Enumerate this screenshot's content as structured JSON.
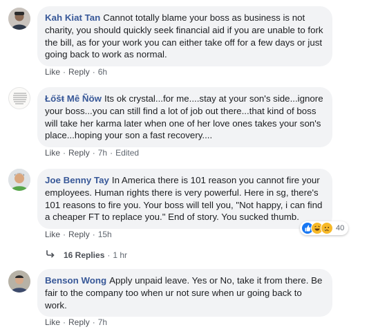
{
  "comments": [
    {
      "name": "Kah Kiat Tan",
      "text": "Cannot totally blame your boss as business is not charity, you should quickly seek financial aid if you are unable to fork the bill, as for your work you can either take off for a few days or just going back to work as normal.",
      "like": "Like",
      "reply": "Reply",
      "time": "6h"
    },
    {
      "name": "Łőšŧ Mê Ñöw",
      "text": "Its ok crystal...for me....stay at your son's side...ignore your boss...you can still find a lot of job out there...that kind of boss will take her karma later when one of her love ones takes your son's place...hoping your son a fast recovery....",
      "like": "Like",
      "reply": "Reply",
      "time": "7h",
      "edited": "Edited"
    },
    {
      "name": "Joe Benny Tay",
      "text": "In America there is 101 reason you cannot fire your employees. Human rights there is very powerful. Here in sg, there's 101 reasons to fire you. Your boss will tell you, \"Not happy, i can find a cheaper FT to replace you.\" End of story. You sucked thumb.",
      "like": "Like",
      "reply": "Reply",
      "time": "15h",
      "reaction_count": "40",
      "replies_label": "16 Replies",
      "replies_time": "1 hr"
    },
    {
      "name": "Benson Wong",
      "text": "Apply unpaid leave. Yes or No, take it from there. Be fair to the company too when ur not sure when ur going back to work.",
      "like": "Like",
      "reply": "Reply",
      "time": "7h"
    }
  ],
  "colors": {
    "name": "#385898",
    "bubble": "#f2f3f5",
    "meta": "#606770",
    "like_blue": "#1877f2",
    "haha_yellow": "#f7b928"
  },
  "icons": [
    "like-reaction-icon",
    "haha-reaction-icon",
    "sad-reaction-icon",
    "reply-arrow-icon"
  ]
}
